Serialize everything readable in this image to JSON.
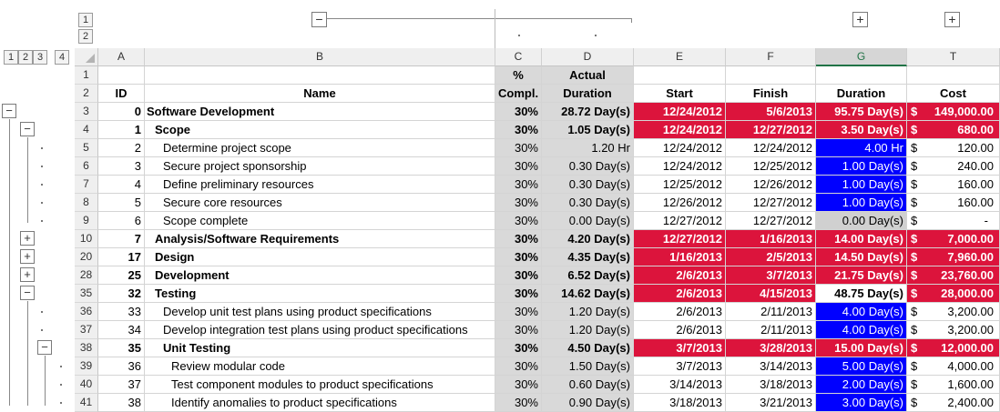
{
  "outline": {
    "col_levels": [
      "1",
      "2"
    ],
    "row_levels": [
      "1",
      "2",
      "3",
      "4"
    ],
    "col_group_buttons": [
      "−",
      "+",
      "+"
    ]
  },
  "columns": [
    "A",
    "B",
    "C",
    "D",
    "E",
    "F",
    "G",
    "T"
  ],
  "header_rows": [
    {
      "row": "1",
      "C": "%",
      "D": "Actual"
    },
    {
      "row": "2",
      "A": "ID",
      "B": "Name",
      "C": "Compl.",
      "D": "Duration",
      "E": "Start",
      "F": "Finish",
      "G": "Duration",
      "T": "Cost"
    }
  ],
  "rows": [
    {
      "row": "3",
      "id": "0",
      "name": "Software Development",
      "indent": 0,
      "bold": true,
      "pct": "30%",
      "dur": "28.72 Day(s)",
      "start": "12/24/2012",
      "finish": "5/6/2013",
      "gdur": "95.75 Day(s)",
      "cost": "149,000.00",
      "date_style": "red",
      "g_style": "red",
      "t_style": "red",
      "outline_btn": "−",
      "outline_level": 0
    },
    {
      "row": "4",
      "id": "1",
      "name": "Scope",
      "indent": 1,
      "bold": true,
      "pct": "30%",
      "dur": "1.05 Day(s)",
      "start": "12/24/2012",
      "finish": "12/27/2012",
      "gdur": "3.50 Day(s)",
      "cost": "680.00",
      "date_style": "red",
      "g_style": "red",
      "t_style": "red",
      "outline_btn": "−",
      "outline_level": 1
    },
    {
      "row": "5",
      "id": "2",
      "name": "Determine project scope",
      "indent": 2,
      "bold": false,
      "pct": "30%",
      "dur": "1.20 Hr",
      "start": "12/24/2012",
      "finish": "12/24/2012",
      "gdur": "4.00 Hr",
      "cost": "120.00",
      "date_style": "",
      "g_style": "blue",
      "t_style": "",
      "outline_btn": "",
      "outline_level": 2
    },
    {
      "row": "6",
      "id": "3",
      "name": "Secure project sponsorship",
      "indent": 2,
      "bold": false,
      "pct": "30%",
      "dur": "0.30 Day(s)",
      "start": "12/24/2012",
      "finish": "12/25/2012",
      "gdur": "1.00 Day(s)",
      "cost": "240.00",
      "date_style": "",
      "g_style": "blue",
      "t_style": "",
      "outline_btn": "",
      "outline_level": 2
    },
    {
      "row": "7",
      "id": "4",
      "name": "Define preliminary resources",
      "indent": 2,
      "bold": false,
      "pct": "30%",
      "dur": "0.30 Day(s)",
      "start": "12/25/2012",
      "finish": "12/26/2012",
      "gdur": "1.00 Day(s)",
      "cost": "160.00",
      "date_style": "",
      "g_style": "blue",
      "t_style": "",
      "outline_btn": "",
      "outline_level": 2
    },
    {
      "row": "8",
      "id": "5",
      "name": "Secure core resources",
      "indent": 2,
      "bold": false,
      "pct": "30%",
      "dur": "0.30 Day(s)",
      "start": "12/26/2012",
      "finish": "12/27/2012",
      "gdur": "1.00 Day(s)",
      "cost": "160.00",
      "date_style": "",
      "g_style": "blue",
      "t_style": "",
      "outline_btn": "",
      "outline_level": 2
    },
    {
      "row": "9",
      "id": "6",
      "name": "Scope complete",
      "indent": 2,
      "bold": false,
      "pct": "30%",
      "dur": "0.00 Day(s)",
      "start": "12/27/2012",
      "finish": "12/27/2012",
      "gdur": "0.00 Day(s)",
      "cost": "-",
      "date_style": "",
      "g_style": "lgray",
      "t_style": "",
      "outline_btn": "",
      "outline_level": 2
    },
    {
      "row": "10",
      "id": "7",
      "name": "Analysis/Software Requirements",
      "indent": 1,
      "bold": true,
      "pct": "30%",
      "dur": "4.20 Day(s)",
      "start": "12/27/2012",
      "finish": "1/16/2013",
      "gdur": "14.00 Day(s)",
      "cost": "7,000.00",
      "date_style": "red",
      "g_style": "red",
      "t_style": "red",
      "outline_btn": "+",
      "outline_level": 1
    },
    {
      "row": "20",
      "id": "17",
      "name": "Design",
      "indent": 1,
      "bold": true,
      "pct": "30%",
      "dur": "4.35 Day(s)",
      "start": "1/16/2013",
      "finish": "2/5/2013",
      "gdur": "14.50 Day(s)",
      "cost": "7,960.00",
      "date_style": "red",
      "g_style": "red",
      "t_style": "red",
      "outline_btn": "+",
      "outline_level": 1
    },
    {
      "row": "28",
      "id": "25",
      "name": "Development",
      "indent": 1,
      "bold": true,
      "pct": "30%",
      "dur": "6.52 Day(s)",
      "start": "2/6/2013",
      "finish": "3/7/2013",
      "gdur": "21.75 Day(s)",
      "cost": "23,760.00",
      "date_style": "red",
      "g_style": "red",
      "t_style": "red",
      "outline_btn": "+",
      "outline_level": 1
    },
    {
      "row": "35",
      "id": "32",
      "name": "Testing",
      "indent": 1,
      "bold": true,
      "pct": "30%",
      "dur": "14.62 Day(s)",
      "start": "2/6/2013",
      "finish": "4/15/2013",
      "gdur": "48.75 Day(s)",
      "cost": "28,000.00",
      "date_style": "red",
      "g_style": "white",
      "t_style": "red",
      "outline_btn": "−",
      "outline_level": 1
    },
    {
      "row": "36",
      "id": "33",
      "name": "Develop unit test plans using product specifications",
      "indent": 2,
      "bold": false,
      "pct": "30%",
      "dur": "1.20 Day(s)",
      "start": "2/6/2013",
      "finish": "2/11/2013",
      "gdur": "4.00 Day(s)",
      "cost": "3,200.00",
      "date_style": "",
      "g_style": "blue",
      "t_style": "",
      "outline_btn": "",
      "outline_level": 2
    },
    {
      "row": "37",
      "id": "34",
      "name": "Develop integration test plans using product specifications",
      "indent": 2,
      "bold": false,
      "pct": "30%",
      "dur": "1.20 Day(s)",
      "start": "2/6/2013",
      "finish": "2/11/2013",
      "gdur": "4.00 Day(s)",
      "cost": "3,200.00",
      "date_style": "",
      "g_style": "blue",
      "t_style": "",
      "outline_btn": "",
      "outline_level": 2
    },
    {
      "row": "38",
      "id": "35",
      "name": "Unit Testing",
      "indent": 2,
      "bold": true,
      "pct": "30%",
      "dur": "4.50 Day(s)",
      "start": "3/7/2013",
      "finish": "3/28/2013",
      "gdur": "15.00 Day(s)",
      "cost": "12,000.00",
      "date_style": "red",
      "g_style": "red",
      "t_style": "red",
      "outline_btn": "−",
      "outline_level": 2
    },
    {
      "row": "39",
      "id": "36",
      "name": "Review modular code",
      "indent": 3,
      "bold": false,
      "pct": "30%",
      "dur": "1.50 Day(s)",
      "start": "3/7/2013",
      "finish": "3/14/2013",
      "gdur": "5.00 Day(s)",
      "cost": "4,000.00",
      "date_style": "",
      "g_style": "blue",
      "t_style": "",
      "outline_btn": "",
      "outline_level": 3
    },
    {
      "row": "40",
      "id": "37",
      "name": "Test component modules to product specifications",
      "indent": 3,
      "bold": false,
      "pct": "30%",
      "dur": "0.60 Day(s)",
      "start": "3/14/2013",
      "finish": "3/18/2013",
      "gdur": "2.00 Day(s)",
      "cost": "1,600.00",
      "date_style": "",
      "g_style": "blue",
      "t_style": "",
      "outline_btn": "",
      "outline_level": 3
    },
    {
      "row": "41",
      "id": "38",
      "name": "Identify anomalies to product specifications",
      "indent": 3,
      "bold": false,
      "pct": "30%",
      "dur": "0.90 Day(s)",
      "start": "3/18/2013",
      "finish": "3/21/2013",
      "gdur": "3.00 Day(s)",
      "cost": "2,400.00",
      "date_style": "",
      "g_style": "blue",
      "t_style": "",
      "outline_btn": "",
      "outline_level": 3
    }
  ],
  "currency_symbol": "$",
  "colors": {
    "red": "#dc143c",
    "blue": "#0000ff",
    "selected_col": "#217346",
    "gray_col": "#d9d9d9"
  }
}
